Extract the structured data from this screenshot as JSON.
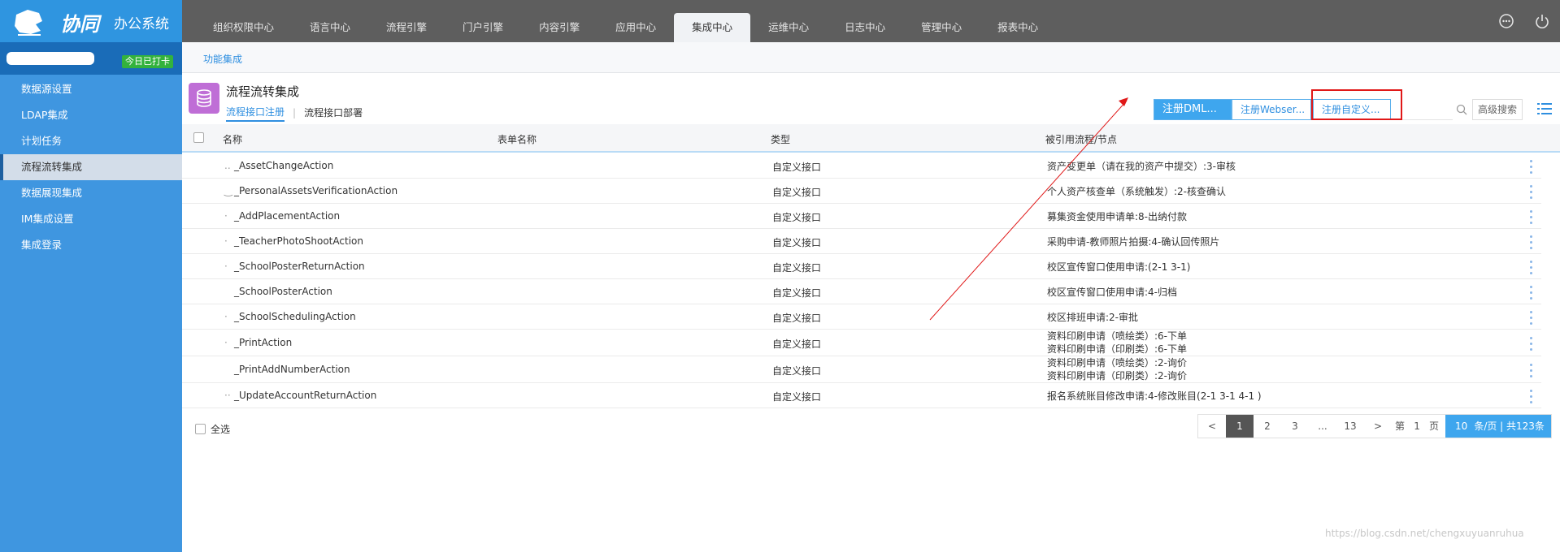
{
  "app": {
    "logo_script": "协同",
    "logo_text": "办公系统"
  },
  "nav": {
    "items": [
      "组织权限中心",
      "语言中心",
      "流程引擎",
      "门户引擎",
      "内容引擎",
      "应用中心",
      "集成中心",
      "运维中心",
      "日志中心",
      "管理中心",
      "报表中心"
    ],
    "active": "集成中心"
  },
  "top_icons": [
    "more-circle-icon",
    "power-icon"
  ],
  "user": {
    "checkin_badge": "今日已打卡"
  },
  "sidebar": {
    "items": [
      "数据源设置",
      "LDAP集成",
      "计划任务",
      "流程流转集成",
      "数据展现集成",
      "IM集成设置",
      "集成登录"
    ],
    "active": "流程流转集成"
  },
  "breadcrumb": "功能集成",
  "page": {
    "title": "流程流转集成",
    "tabs": [
      "流程接口注册",
      "流程接口部署"
    ],
    "tab_separator": "|"
  },
  "toolbar": {
    "btn_dml": "注册DML...",
    "btn_webser": "注册Webser...",
    "btn_custom": "注册自定义...",
    "search_placeholder": "",
    "advanced_search": "高级搜索"
  },
  "table": {
    "columns": [
      "名称",
      "表单名称",
      "类型",
      "被引用流程/节点"
    ],
    "rows": [
      {
        "prefix": "..",
        "name": "_AssetChangeAction",
        "form": "",
        "type": "自定义接口",
        "nodes": [
          "资产变更单（请在我的资产中提交）:3-审核"
        ]
      },
      {
        "prefix": "‿",
        "name": "_PersonalAssetsVerificationAction",
        "form": "",
        "type": "自定义接口",
        "nodes": [
          "个人资产核查单（系统触发）:2-核查确认"
        ]
      },
      {
        "prefix": "·",
        "name": "_AddPlacementAction",
        "form": "",
        "type": "自定义接口",
        "nodes": [
          "募集资金使用申请单:8-出纳付款"
        ]
      },
      {
        "prefix": "·",
        "name": "_TeacherPhotoShootAction",
        "form": "",
        "type": "自定义接口",
        "nodes": [
          "采购申请-教师照片拍摄:4-确认回传照片"
        ]
      },
      {
        "prefix": "·",
        "name": "_SchoolPosterReturnAction",
        "form": "",
        "type": "自定义接口",
        "nodes": [
          "校区宣传窗口使用申请:(2-1 3-1)"
        ]
      },
      {
        "prefix": "",
        "name": "_SchoolPosterAction",
        "form": "",
        "type": "自定义接口",
        "nodes": [
          "校区宣传窗口使用申请:4-归档"
        ]
      },
      {
        "prefix": "·",
        "name": "_SchoolSchedulingAction",
        "form": "",
        "type": "自定义接口",
        "nodes": [
          "校区排班申请:2-审批"
        ]
      },
      {
        "prefix": "·",
        "name": "_PrintAction",
        "form": "",
        "type": "自定义接口",
        "nodes": [
          "资料印刷申请（喷绘类）:6-下单",
          "资料印刷申请（印刷类）:6-下单"
        ]
      },
      {
        "prefix": "",
        "name": "_PrintAddNumberAction",
        "form": "",
        "type": "自定义接口",
        "nodes": [
          "资料印刷申请（喷绘类）:2-询价",
          "资料印刷申请（印刷类）:2-询价"
        ]
      },
      {
        "prefix": "··",
        "name": "_UpdateAccountReturnAction",
        "form": "",
        "type": "自定义接口",
        "nodes": [
          "报名系统账目修改申请:4-修改账目(2-1 3-1 4-1 )"
        ]
      }
    ]
  },
  "footer": {
    "select_all": "全选",
    "pagination": {
      "prev": "<",
      "pages": [
        "1",
        "2",
        "3",
        "...",
        "13"
      ],
      "current": "1",
      "next": ">",
      "goto_prefix": "第",
      "goto_value": "1",
      "goto_suffix": "页",
      "page_size": "10",
      "page_size_suffix": "条/页 | 共123条"
    }
  },
  "watermark": "https://blog.csdn.net/chengxuyuanruhua",
  "colors": {
    "topbar": "#5e5e5e",
    "logo_bg": "#2f95e0",
    "sidebar": "#3f96e0",
    "accent": "#2f8fe0",
    "checkin": "#33b23d",
    "page_icon": "#bf6ed6",
    "annotation": "#e01818"
  }
}
